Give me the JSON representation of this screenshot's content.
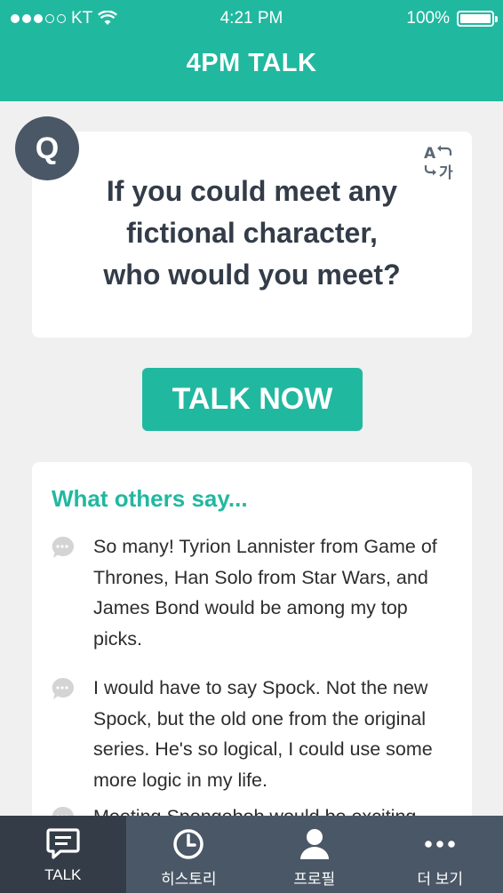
{
  "status_bar": {
    "carrier": "KT",
    "time": "4:21 PM",
    "battery": "100%",
    "battery_level": 1.0,
    "signal_bars": 3
  },
  "header": {
    "title": "4PM TALK"
  },
  "question_card": {
    "badge": "Q",
    "lines": [
      "If you could meet any",
      "fictional character,",
      "who would you meet?"
    ],
    "translate_icon": "translate-icon"
  },
  "talk_button": {
    "label": "TALK NOW"
  },
  "others": {
    "title": "What others say...",
    "comments": [
      {
        "text": "So many! Tyrion Lannister from Game of Thrones, Han Solo from Star Wars, and James Bond would be among my top picks."
      },
      {
        "text": "I would have to say Spock. Not the new Spock, but the old one from the original series. He's so logical, I could use some more logic in my life."
      },
      {
        "text": "Meeting Spongebob would be exciting"
      }
    ]
  },
  "tabbar": {
    "tabs": [
      {
        "label": "TALK",
        "icon": "chat-icon"
      },
      {
        "label": "히스토리",
        "icon": "clock-icon"
      },
      {
        "label": "프로필",
        "icon": "person-icon"
      },
      {
        "label": "더 보기",
        "icon": "more-icon"
      }
    ]
  },
  "colors": {
    "accent": "#21b8a0",
    "dark": "#4a5766",
    "background": "#f0f0f0"
  }
}
